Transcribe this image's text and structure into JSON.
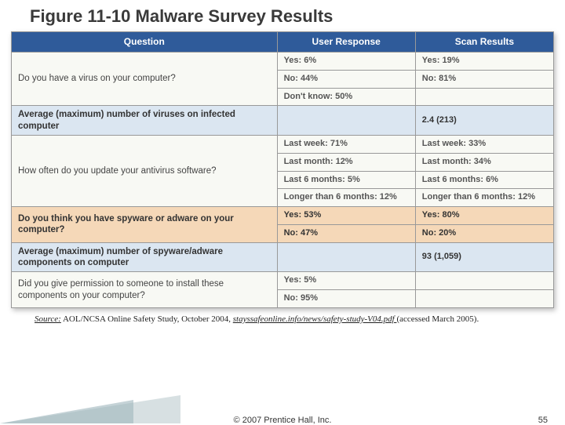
{
  "title": "Figure 11-10 Malware Survey Results",
  "headers": {
    "q": "Question",
    "r": "User Response",
    "s": "Scan Results"
  },
  "rows": [
    {
      "q": "Do you have a virus on your computer?",
      "span": 3,
      "cells": [
        {
          "r": "Yes: 6%",
          "s": "Yes: 19%"
        },
        {
          "r": "No: 44%",
          "s": "No: 81%"
        },
        {
          "r": "Don't know: 50%",
          "s": ""
        }
      ],
      "class": "sec-light"
    },
    {
      "q": "Average (maximum) number of viruses on infected computer",
      "span": 1,
      "cells": [
        {
          "r": "",
          "s": "2.4 (213)"
        }
      ],
      "class": "sec-blue"
    },
    {
      "q": "How often do you update your antivirus software?",
      "span": 4,
      "cells": [
        {
          "r": "Last week: 71%",
          "s": "Last week: 33%"
        },
        {
          "r": "Last month: 12%",
          "s": "Last month: 34%"
        },
        {
          "r": "Last 6 months: 5%",
          "s": "Last 6 months: 6%"
        },
        {
          "r": "Longer than 6 months: 12%",
          "s": "Longer than 6 months: 12%"
        }
      ],
      "class": "sec-light"
    },
    {
      "q": "Do you think you have spyware or adware on your computer?",
      "span": 2,
      "cells": [
        {
          "r": "Yes: 53%",
          "s": "Yes: 80%"
        },
        {
          "r": "No: 47%",
          "s": "No: 20%"
        }
      ],
      "class": "sec-peach"
    },
    {
      "q": "Average (maximum) number of spyware/adware components on computer",
      "span": 1,
      "cells": [
        {
          "r": "",
          "s": "93 (1,059)"
        }
      ],
      "class": "sec-blue"
    },
    {
      "q": "Did you give permission to someone to install these components on your computer?",
      "span": 2,
      "cells": [
        {
          "r": "Yes: 5%",
          "s": ""
        },
        {
          "r": "No: 95%",
          "s": ""
        }
      ],
      "class": "sec-light"
    }
  ],
  "source": {
    "label": "Source:",
    "text": "  AOL/NCSA Online Safety Study, October 2004, ",
    "url": "stayssafeonline.info/news/safety-study-V04.pdf ",
    "tail": "(accessed March 2005)."
  },
  "copyright": "© 2007 Prentice Hall, Inc.",
  "page": "55",
  "chart_data": {
    "type": "table",
    "title": "Figure 11-10 Malware Survey Results",
    "columns": [
      "Question",
      "User Response",
      "Scan Results"
    ],
    "data": [
      [
        "Do you have a virus on your computer?",
        "Yes: 6%",
        "Yes: 19%"
      ],
      [
        "",
        "No: 44%",
        "No: 81%"
      ],
      [
        "",
        "Don't know: 50%",
        ""
      ],
      [
        "Average (maximum) number of viruses on infected computer",
        "",
        "2.4 (213)"
      ],
      [
        "How often do you update your antivirus software?",
        "Last week: 71%",
        "Last week: 33%"
      ],
      [
        "",
        "Last month: 12%",
        "Last month: 34%"
      ],
      [
        "",
        "Last 6 months: 5%",
        "Last 6 months: 6%"
      ],
      [
        "",
        "Longer than 6 months: 12%",
        "Longer than 6 months: 12%"
      ],
      [
        "Do you think you have spyware or adware on your computer?",
        "Yes: 53%",
        "Yes: 80%"
      ],
      [
        "",
        "No: 47%",
        "No: 20%"
      ],
      [
        "Average (maximum) number of spyware/adware components on computer",
        "",
        "93 (1,059)"
      ],
      [
        "Did you give permission to someone to install these components on your computer?",
        "Yes: 5%",
        ""
      ],
      [
        "",
        "No: 95%",
        ""
      ]
    ]
  }
}
